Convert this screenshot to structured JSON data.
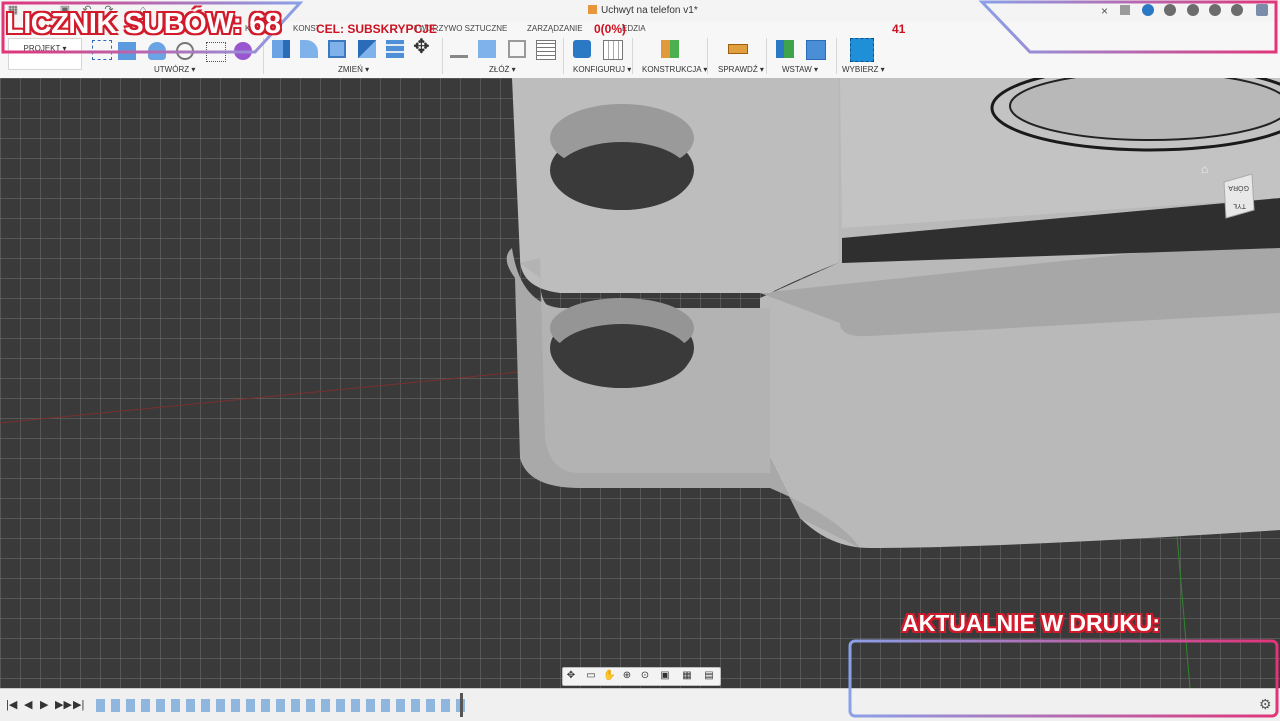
{
  "app": {
    "document_title": "Uchwyt na telefon v1*",
    "close_tab": "×"
  },
  "ribbon": {
    "workspace_label": "PROJEKT ▾",
    "tabs": [
      "KA",
      "KONST",
      "TWORZYWO SZTUCZNE",
      "ZARZĄDZANIE",
      "EDZIA"
    ],
    "groups": {
      "create": "UTWÓRZ ▾",
      "modify": "ZMIEŃ ▾",
      "assemble": "ZŁÓŻ ▾",
      "configure": "KONFIGURUJ ▾",
      "construct": "KONSTRUKCJA ▾",
      "inspect": "SPRAWDŹ ▾",
      "insert": "WSTAW ▾",
      "select": "WYBIERZ ▾"
    }
  },
  "overlay": {
    "subs_counter": "LICZNIK SUBÓW: 68",
    "goal_label": "CEL: SUBSKRYPCJE",
    "goal_percent": "0(0%)",
    "goal_number": "41",
    "print_label": "AKTUALNIE W DRUKU:",
    "colors": {
      "red": "#d11a2a",
      "frame_pink": "#e0357a",
      "frame_blue": "#8aa0e8"
    }
  },
  "viewport": {
    "viewcube_top": "GÓRA",
    "viewcube_front": "TYŁ",
    "home_icon": "home-icon"
  },
  "navbar": {
    "icons": [
      "orbit-icon",
      "look-at-icon",
      "pan-icon",
      "zoom-icon",
      "zoom-window-icon",
      "display-icon",
      "grid-icon",
      "viewports-icon"
    ]
  },
  "timeline": {
    "controls": [
      "|◀",
      "◀",
      "▶",
      "▶▶",
      "▶|"
    ]
  }
}
